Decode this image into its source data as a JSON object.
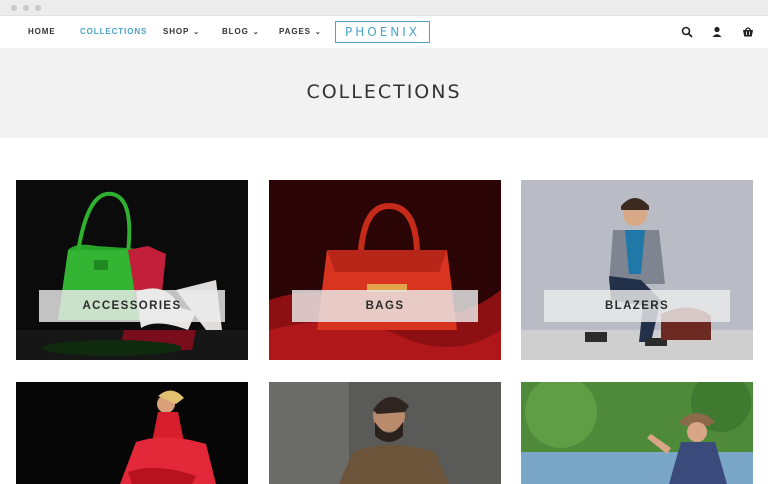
{
  "nav": {
    "items": [
      {
        "label": "HOME"
      },
      {
        "label": "COLLECTIONS",
        "active": true
      },
      {
        "label": "SHOP"
      },
      {
        "label": "BLOG"
      },
      {
        "label": "PAGES"
      }
    ],
    "logo": "PHOENIX",
    "accent_color": "#4aa3c8",
    "icons": [
      "search-icon",
      "user-icon",
      "cart-icon"
    ]
  },
  "hero": {
    "title": "COLLECTIONS"
  },
  "collections": [
    {
      "label": "ACCESSORIES"
    },
    {
      "label": "BAGS"
    },
    {
      "label": "BLAZERS"
    },
    {
      "label": ""
    },
    {
      "label": ""
    },
    {
      "label": ""
    }
  ]
}
